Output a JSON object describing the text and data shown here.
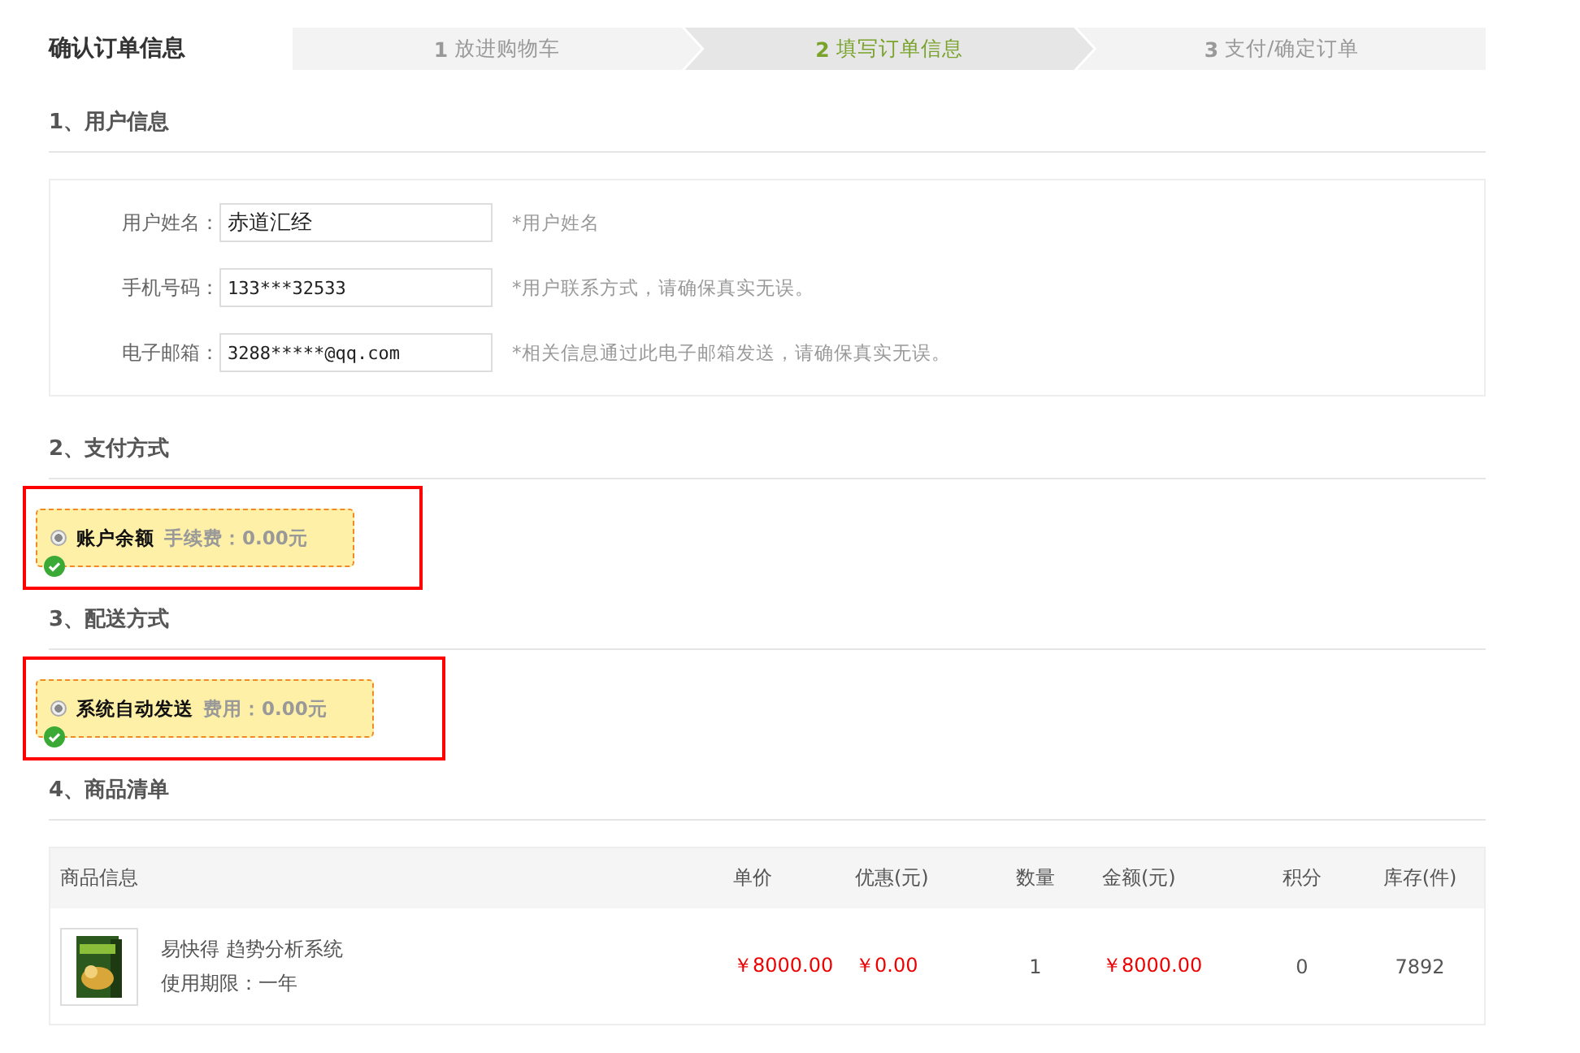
{
  "page_title": "确认订单信息",
  "steps": [
    {
      "number": "1",
      "label": "放进购物车",
      "selected": false
    },
    {
      "number": "2",
      "label": "填写订单信息",
      "selected": true
    },
    {
      "number": "3",
      "label": "支付/确定订单",
      "selected": false
    }
  ],
  "user_section": {
    "title": "1、用户信息",
    "fields": [
      {
        "label": "用户姓名：",
        "value": "赤道汇经",
        "hint": "*用户姓名",
        "kind": "text"
      },
      {
        "label": "手机号码：",
        "value": "133***32533",
        "hint": "*用户联系方式，请确保真实无误。",
        "kind": "mono"
      },
      {
        "label": "电子邮箱：",
        "value": "3288*****@qq.com",
        "hint": "*相关信息通过此电子邮箱发送，请确保真实无误。",
        "kind": "mono"
      }
    ]
  },
  "payment_section": {
    "title": "2、支付方式",
    "options": [
      {
        "name": "账户余额",
        "fee": "手续费：0.00元",
        "selected": true
      }
    ]
  },
  "delivery_section": {
    "title": "3、配送方式",
    "options": [
      {
        "name": "系统自动发送",
        "fee": "费用：0.00元",
        "selected": true
      }
    ]
  },
  "goods_section": {
    "title": "4、商品清单",
    "table": {
      "columns": [
        "商品信息",
        "单价",
        "优惠(元)",
        "数量",
        "金额(元)",
        "积分",
        "库存(件)"
      ],
      "rows": [
        {
          "name": "易快得 趋势分析系统",
          "period": "使用期限：一年",
          "price": "￥8000.00",
          "discount": "￥0.00",
          "quantity": "1",
          "amount": "￥8000.00",
          "points": "0",
          "stock": "7892"
        }
      ]
    }
  }
}
